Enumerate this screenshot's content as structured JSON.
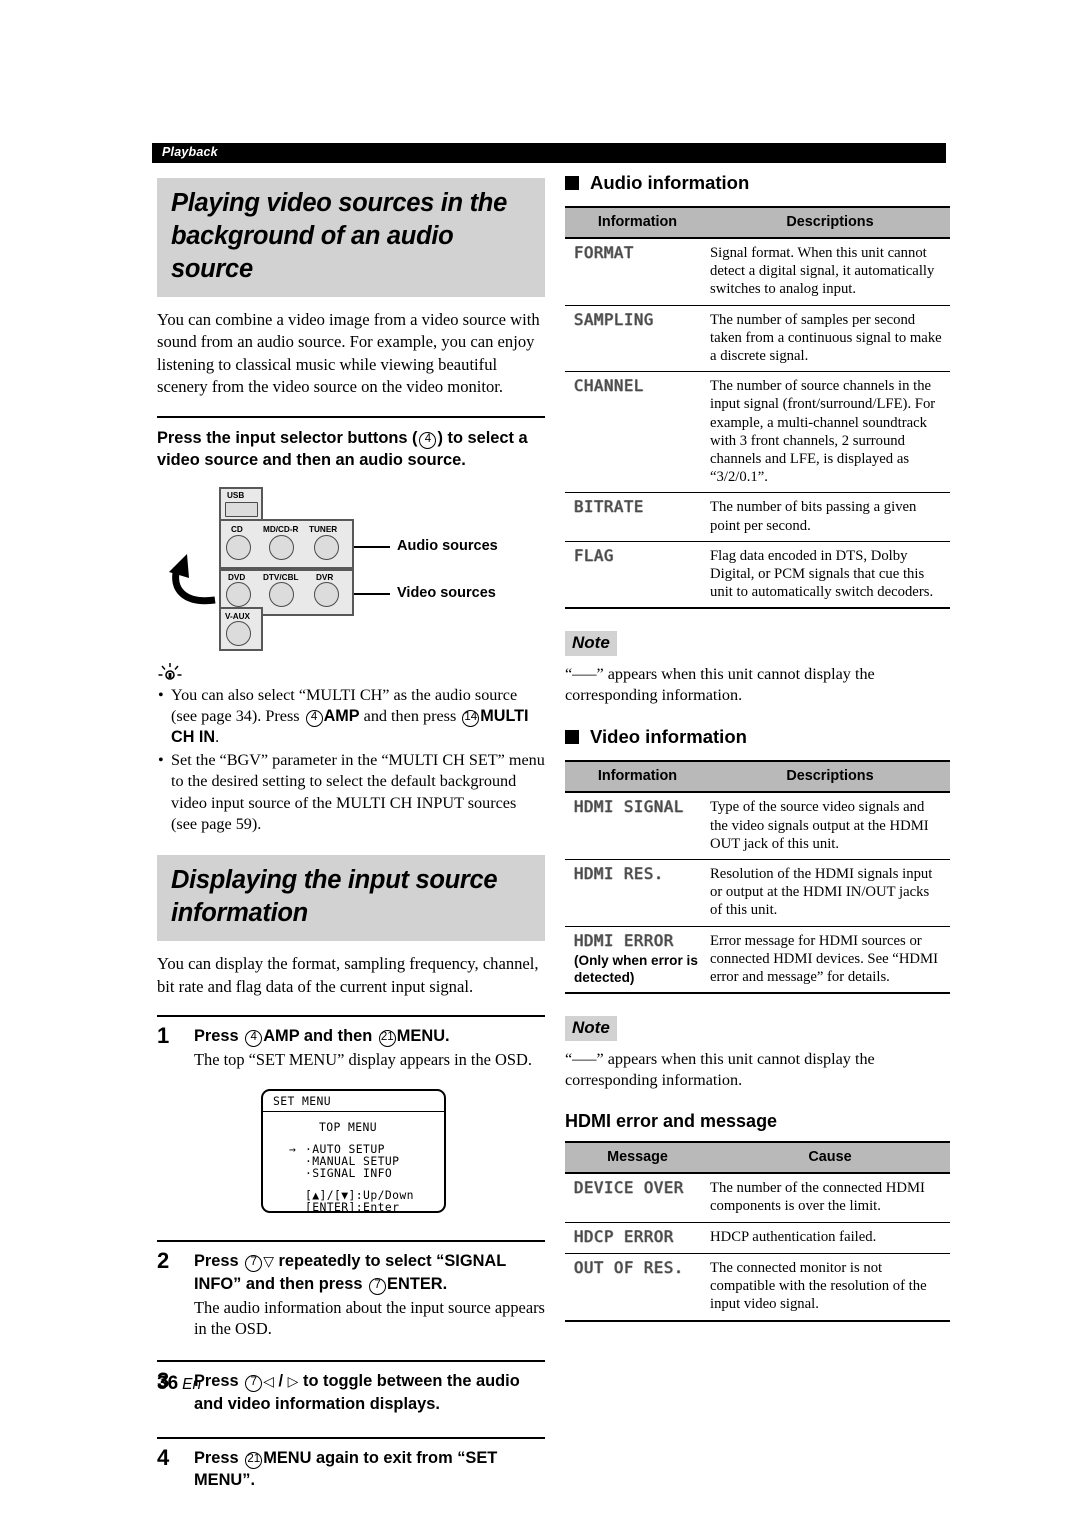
{
  "running_head": "Playback",
  "page_number": {
    "num": "36",
    "lang": "En"
  },
  "left": {
    "section1": {
      "title": "Playing video sources in the background of an audio source",
      "intro": "You can combine a video image from a video source with sound from an audio source. For example, you can enjoy listening to classical music while viewing beautiful scenery from the video source on the video monitor.",
      "instruction_pre": "Press the input selector buttons (",
      "instruction_num": "4",
      "instruction_post": ") to select a video source and then an audio source.",
      "diagram": {
        "buttons": [
          "USB",
          "CD",
          "MD/CD-R",
          "TUNER",
          "DVD",
          "DTV/CBL",
          "DVR",
          "V-AUX"
        ],
        "label_audio": "Audio sources",
        "label_video": "Video sources",
        "arrow_icon": "curved-arrow-icon"
      },
      "tips": [
        {
          "p1": "You can also select “MULTI CH” as the audio source (see page 34). Press ",
          "n1": "4",
          "p2": "AMP",
          "p3": " and then press ",
          "n2": "14",
          "p4": "MULTI CH IN",
          "p5": "."
        },
        {
          "text": "Set the “BGV” parameter in the “MULTI CH SET” menu to the desired setting to select the default background video input source of the MULTI CH INPUT sources (see page 59)."
        }
      ]
    },
    "section2": {
      "title": "Displaying the input source information",
      "intro": "You can display the format, sampling frequency, channel, bit rate and flag data of the current input signal.",
      "steps": [
        {
          "num": "1",
          "title_pre": "Press ",
          "n1": "4",
          "b1": "AMP",
          "mid": " and then ",
          "n2": "21",
          "b2": "MENU",
          "title_post": ".",
          "desc": "The top “SET MENU” display appears in the OSD."
        },
        {
          "num": "2",
          "title_pre": "Press ",
          "n1": "7",
          "glyph1": "▽",
          "mid": " repeatedly to select “SIGNAL INFO” and then press ",
          "n2": "7",
          "b2": "ENTER",
          "title_post": ".",
          "desc": "The audio information about the input source appears in the OSD."
        },
        {
          "num": "3",
          "title_pre": "Press ",
          "n1": "7",
          "glyph1": "◁",
          "glyph_sep": " / ",
          "glyph2": "▷",
          "mid": " to toggle between the audio and video information displays.",
          "desc": ""
        },
        {
          "num": "4",
          "title_pre": "Press ",
          "n2": "21",
          "b2": "MENU",
          "mid": " again to exit from “SET MENU”.",
          "desc": ""
        }
      ],
      "osd": {
        "header": "SET MENU",
        "top_menu": "TOP MENU",
        "cursor": "→",
        "items": [
          "·AUTO SETUP",
          "·MANUAL SETUP",
          "·SIGNAL INFO"
        ],
        "help1": "[▲]/[▼]:Up/Down",
        "help2": "[ENTER]:Enter"
      }
    }
  },
  "right": {
    "audio_info": {
      "heading": "Audio information",
      "columns": [
        "Information",
        "Descriptions"
      ],
      "rows": [
        {
          "name": "FORMAT",
          "desc": "Signal format. When this unit cannot detect a digital signal, it automatically switches to analog input."
        },
        {
          "name": "SAMPLING",
          "desc": "The number of samples per second taken from a continuous signal to make a discrete signal."
        },
        {
          "name": "CHANNEL",
          "desc": "The number of source channels in the input signal (front/surround/LFE). For example, a multi-channel soundtrack with 3 front channels, 2 surround channels and LFE, is displayed as “3/2/0.1”."
        },
        {
          "name": "BITRATE",
          "desc": "The number of bits passing a given point per second."
        },
        {
          "name": "FLAG",
          "desc": "Flag data encoded in DTS, Dolby Digital, or PCM signals that cue this unit to automatically switch decoders."
        }
      ]
    },
    "note1": {
      "tag": "Note",
      "text": "“–––” appears when this unit cannot display the corresponding information."
    },
    "video_info": {
      "heading": "Video information",
      "columns": [
        "Information",
        "Descriptions"
      ],
      "rows": [
        {
          "name": "HDMI SIGNAL",
          "sub": "",
          "desc": "Type of the source video signals and the video signals output at the HDMI OUT jack of this unit."
        },
        {
          "name": "HDMI RES.",
          "sub": "",
          "desc": "Resolution of the HDMI signals input or output at the HDMI IN/OUT jacks of this unit."
        },
        {
          "name": "HDMI ERROR",
          "sub": "(Only when error is detected)",
          "desc": "Error message for HDMI sources or connected HDMI devices. See “HDMI error and message” for details."
        }
      ]
    },
    "note2": {
      "tag": "Note",
      "text": "“–––” appears when this unit cannot display the corresponding information."
    },
    "hdmi_error": {
      "heading": "HDMI error and message",
      "columns": [
        "Message",
        "Cause"
      ],
      "rows": [
        {
          "name": "DEVICE OVER",
          "desc": "The number of the connected HDMI components is over the limit."
        },
        {
          "name": "HDCP ERROR",
          "desc": "HDCP authentication failed."
        },
        {
          "name": "OUT OF RES.",
          "desc": "The connected monitor is not compatible with the resolution of the input video signal."
        }
      ]
    }
  }
}
